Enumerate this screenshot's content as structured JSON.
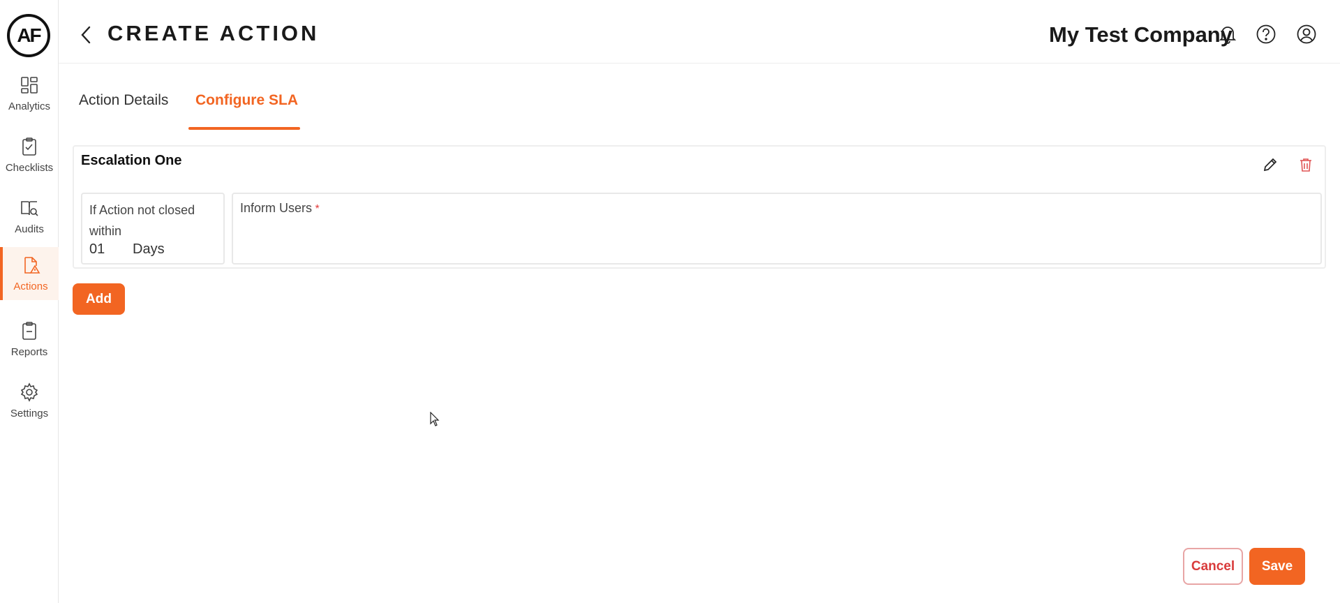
{
  "brand": {
    "logo_text": "AF",
    "accent": "#f26522"
  },
  "sidebar": {
    "items": [
      {
        "label": "Analytics",
        "icon": "analytics-icon",
        "active": false
      },
      {
        "label": "Checklists",
        "icon": "checklist-icon",
        "active": false
      },
      {
        "label": "Audits",
        "icon": "audit-icon",
        "active": false
      },
      {
        "label": "Actions",
        "icon": "action-warning-icon",
        "active": true
      },
      {
        "label": "Reports",
        "icon": "report-icon",
        "active": false
      },
      {
        "label": "Settings",
        "icon": "gear-icon",
        "active": false
      }
    ]
  },
  "header": {
    "title": "CREATE ACTION",
    "company": "My Test Company",
    "icons": [
      "bell-icon",
      "help-icon",
      "user-icon"
    ]
  },
  "tabs": [
    {
      "label": "Action Details",
      "active": false
    },
    {
      "label": "Configure SLA",
      "active": true
    }
  ],
  "escalation": {
    "title": "Escalation One",
    "condition_label": "If Action not closed within",
    "days_value": "01",
    "days_unit": "Days",
    "inform_label": "Inform Users",
    "required_mark": "*"
  },
  "buttons": {
    "add": "Add",
    "cancel": "Cancel",
    "save": "Save"
  }
}
